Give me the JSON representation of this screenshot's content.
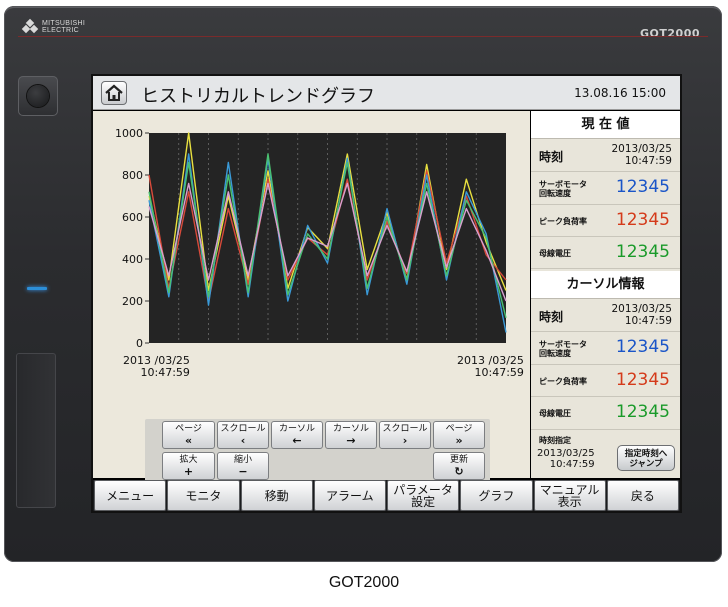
{
  "device": {
    "brand": "MITSUBISHI ELECTRIC",
    "brand_line1": "MITSUBISHI",
    "brand_line2": "ELECTRIC",
    "model_logo": "GOT2000"
  },
  "screen": {
    "title": "ヒストリカルトレンドグラフ",
    "datetime": "13.08.16  15:00",
    "home_icon": "home-icon"
  },
  "chart": {
    "y_ticks": [
      "1000",
      "800",
      "600",
      "400",
      "200",
      "0"
    ],
    "start_date": "2013 /03/25",
    "start_time": "10:47:59",
    "end_date": "2013 /03/25",
    "end_time": "10:47:59",
    "plot_background": "#242424"
  },
  "chart_data": {
    "type": "line",
    "ylim": [
      0,
      1000
    ],
    "x": [
      0,
      1,
      2,
      3,
      4,
      5,
      6,
      7,
      8,
      9,
      10,
      11,
      12,
      13,
      14,
      15,
      16,
      17,
      18
    ],
    "series": [
      {
        "color": "#e8e040",
        "values": [
          700,
          300,
          1000,
          250,
          700,
          300,
          820,
          260,
          550,
          450,
          900,
          350,
          620,
          300,
          850,
          350,
          780,
          480,
          250
        ]
      },
      {
        "color": "#d84a3a",
        "values": [
          800,
          260,
          720,
          200,
          640,
          280,
          780,
          300,
          500,
          420,
          780,
          300,
          580,
          330,
          820,
          380,
          700,
          420,
          300
        ]
      },
      {
        "color": "#3a9ad8",
        "values": [
          680,
          220,
          900,
          180,
          860,
          220,
          880,
          200,
          560,
          380,
          880,
          230,
          640,
          280,
          800,
          300,
          720,
          520,
          50
        ]
      },
      {
        "color": "#4ac070",
        "values": [
          720,
          240,
          860,
          220,
          800,
          240,
          900,
          230,
          520,
          400,
          860,
          260,
          600,
          300,
          760,
          320,
          680,
          500,
          120
        ]
      },
      {
        "color": "#d8a0d0",
        "values": [
          650,
          320,
          760,
          300,
          720,
          320,
          760,
          320,
          500,
          460,
          760,
          320,
          560,
          340,
          720,
          360,
          640,
          440,
          200
        ]
      }
    ]
  },
  "controls": {
    "page_prev": "ページ",
    "page_prev_icon": "«",
    "scroll_left": "スクロール",
    "scroll_left_icon": "‹",
    "cursor_left": "カーソル",
    "cursor_left_icon": "←",
    "cursor_right": "カーソル",
    "cursor_right_icon": "→",
    "scroll_right": "スクロール",
    "scroll_right_icon": "›",
    "page_next": "ページ",
    "page_next_icon": "»",
    "zoom_in": "拡大",
    "zoom_in_icon": "+",
    "zoom_out": "縮小",
    "zoom_out_icon": "−",
    "refresh": "更新",
    "refresh_icon": "↻"
  },
  "current_values": {
    "header": "現 在 値",
    "time_label": "時刻",
    "time_date": "2013/03/25",
    "time_time": "10:47:59",
    "rows": [
      {
        "label_line1": "サーボモータ",
        "label_line2": "回転速度",
        "value": "12345",
        "color": "#1a55c8"
      },
      {
        "label_line1": "ピーク負荷率",
        "label_line2": "",
        "value": "12345",
        "color": "#d43a1a"
      },
      {
        "label_line1": "母線電圧",
        "label_line2": "",
        "value": "12345",
        "color": "#1a9a2a"
      }
    ]
  },
  "cursor_info": {
    "header": "カーソル情報",
    "time_label": "時刻",
    "time_date": "2013/03/25",
    "time_time": "10:47:59",
    "rows": [
      {
        "label_line1": "サーボモータ",
        "label_line2": "回転速度",
        "value": "12345",
        "color": "#1a55c8"
      },
      {
        "label_line1": "ピーク負荷率",
        "label_line2": "",
        "value": "12345",
        "color": "#d43a1a"
      },
      {
        "label_line1": "母線電圧",
        "label_line2": "",
        "value": "12345",
        "color": "#1a9a2a"
      }
    ],
    "time_spec_label": "時刻指定",
    "time_spec_date": "2013/03/25",
    "time_spec_time": "10:47:59",
    "jump_line1": "指定時刻へ",
    "jump_line2": "ジャンプ"
  },
  "menu": [
    {
      "label": "メニュー"
    },
    {
      "label": "モニタ"
    },
    {
      "label": "移動"
    },
    {
      "label": "アラーム"
    },
    {
      "label": "パラメータ\n設定"
    },
    {
      "label": "グラフ"
    },
    {
      "label": "マニュアル\n表示"
    },
    {
      "label": "戻る"
    }
  ],
  "caption": "GOT2000"
}
